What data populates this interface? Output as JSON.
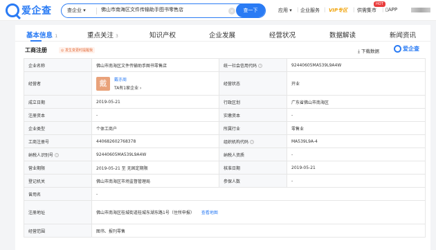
{
  "header": {
    "logo_text": "爱企查",
    "search_type": "查企业 ▾",
    "search_value": "佛山市南海区文件传输助手图书零售店",
    "clear_icon": "×",
    "search_button": "查一下",
    "nav": {
      "app": "应用 ▾",
      "enterprise_service": "企业服务",
      "vip": "VIP专区",
      "supply": "供需集市",
      "hot_badge": "HOT",
      "download_app": "APP"
    }
  },
  "tabs": [
    {
      "label": "基本信息",
      "count": "1"
    },
    {
      "label": "重点关注",
      "count": "3"
    },
    {
      "label": "知识产权",
      "count": ""
    },
    {
      "label": "企业发展",
      "count": ""
    },
    {
      "label": "经营状况",
      "count": ""
    },
    {
      "label": "数据解读",
      "count": ""
    },
    {
      "label": "新闻资讯",
      "count": ""
    }
  ],
  "section": {
    "title": "工商注册",
    "tip": "◎ 发生变更时提醒我",
    "download": "⤓ 下载数据",
    "logo_text": "爱企查"
  },
  "table": {
    "company_name_label": "企业名称",
    "company_name": "佛山市南海区文件传输助手图书零售店",
    "credit_code_label": "统一社会信用代码",
    "credit_code": "92440605MA539L9A4W",
    "operator_label": "经营者",
    "operator_avatar": "戴",
    "operator_name": "戴亦周",
    "operator_sub": "TA有1家企业 ›",
    "status_label": "经营状态",
    "status": "开业",
    "founded_label": "成立日期",
    "founded": "2019-05-21",
    "region_label": "行政区划",
    "region": "广东省佛山市南海区",
    "reg_capital_label": "注册资本",
    "reg_capital": "-",
    "paid_capital_label": "实缴资本",
    "paid_capital": "-",
    "type_label": "企业类型",
    "type": "个体工商户",
    "industry_label": "所属行业",
    "industry": "零售业",
    "reg_no_label": "工商注册号",
    "reg_no": "440682602768378",
    "org_code_label": "组织机构代码",
    "org_code": "MA539L9A-4",
    "tax_id_label": "纳税人识别号",
    "tax_id": "92440605MA539L9A4W",
    "taxpayer_label": "纳税人资质",
    "taxpayer": "-",
    "term_label": "营业期限",
    "term": "2019-05-21 至 无固定期限",
    "approval_label": "核准日期",
    "approval": "2019-05-21",
    "authority_label": "登记机关",
    "authority": "佛山市南海区市场监督管理局",
    "insured_label": "参保人数",
    "insured": "-",
    "former_name_label": "曾用名",
    "former_name": "-",
    "address_label": "注册地址",
    "address": "佛山市南海区桂城街道桂城东湖东路1号（住所申报）",
    "map_link": "查看地图",
    "scope_label": "经营范围",
    "scope": "图书、报刊零售"
  }
}
